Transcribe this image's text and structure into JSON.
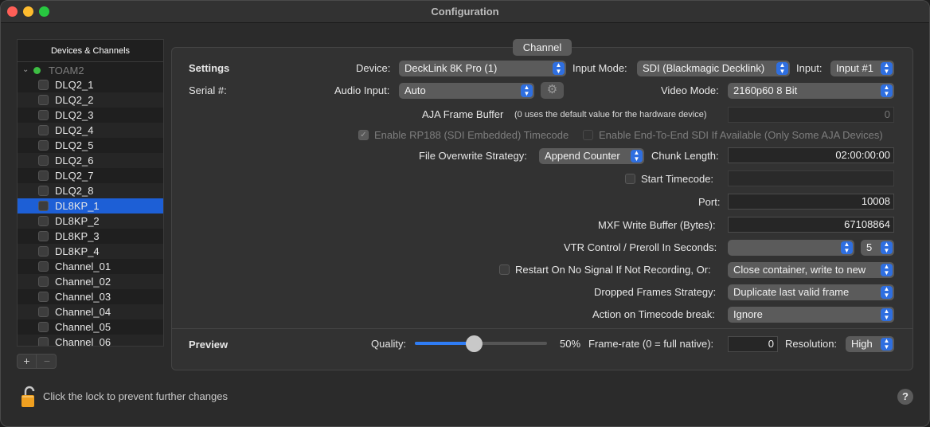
{
  "window": {
    "title": "Configuration"
  },
  "sidebar": {
    "header": "Devices & Channels",
    "root_label": "TOAM2",
    "items": [
      "DLQ2_1",
      "DLQ2_2",
      "DLQ2_3",
      "DLQ2_4",
      "DLQ2_5",
      "DLQ2_6",
      "DLQ2_7",
      "DLQ2_8",
      "DL8KP_1",
      "DL8KP_2",
      "DL8KP_3",
      "DL8KP_4",
      "Channel_01",
      "Channel_02",
      "Channel_03",
      "Channel_04",
      "Channel_05",
      "Channel_06"
    ],
    "selected": "DL8KP_1",
    "add_label": "+",
    "remove_label": "−"
  },
  "tab": {
    "label": "Channel"
  },
  "settings": {
    "section_label": "Settings",
    "serial_label": "Serial #:",
    "device_label": "Device:",
    "device_value": "DeckLink 8K Pro (1)",
    "input_mode_label": "Input Mode:",
    "input_mode_value": "SDI (Blackmagic Decklink)",
    "input_label": "Input:",
    "input_value": "Input #1",
    "audio_input_label": "Audio Input:",
    "audio_input_value": "Auto",
    "video_mode_label": "Video Mode:",
    "video_mode_value": "2160p60 8 Bit",
    "aja_label": "AJA Frame Buffer",
    "aja_hint": "(0 uses the default value for the hardware device)",
    "aja_value": "0",
    "rp188_label": "Enable RP188 (SDI Embedded) Timecode",
    "e2e_label": "Enable End-To-End SDI If Available (Only Some AJA Devices)",
    "overwrite_label": "File Overwrite Strategy:",
    "overwrite_value": "Append Counter",
    "chunk_label": "Chunk Length:",
    "chunk_value": "02:00:00:00",
    "start_tc_label": "Start Timecode:",
    "start_tc_value": "",
    "port_label": "Port:",
    "port_value": "10008",
    "mxf_label": "MXF Write Buffer (Bytes):",
    "mxf_value": "67108864",
    "vtr_label": "VTR Control / Preroll In Seconds:",
    "vtr_value": "",
    "preroll_value": "5",
    "restart_label": "Restart On No Signal If Not Recording, Or:",
    "restart_value": "Close container, write to new",
    "dropped_label": "Dropped Frames Strategy:",
    "dropped_value": "Duplicate last valid frame",
    "tc_break_label": "Action on Timecode break:",
    "tc_break_value": "Ignore"
  },
  "preview": {
    "section_label": "Preview",
    "quality_label": "Quality:",
    "quality_percent": 50,
    "quality_text": "50%",
    "framerate_label": "Frame-rate (0 = full native):",
    "framerate_value": "0",
    "resolution_label": "Resolution:",
    "resolution_value": "High"
  },
  "footer": {
    "lock_text": "Click the lock to prevent further changes",
    "help_label": "?"
  },
  "colors": {
    "accent": "#2f6fe0",
    "selection": "#1d5fd6",
    "status_green": "#3dbd43",
    "lock": "#f0a020"
  }
}
